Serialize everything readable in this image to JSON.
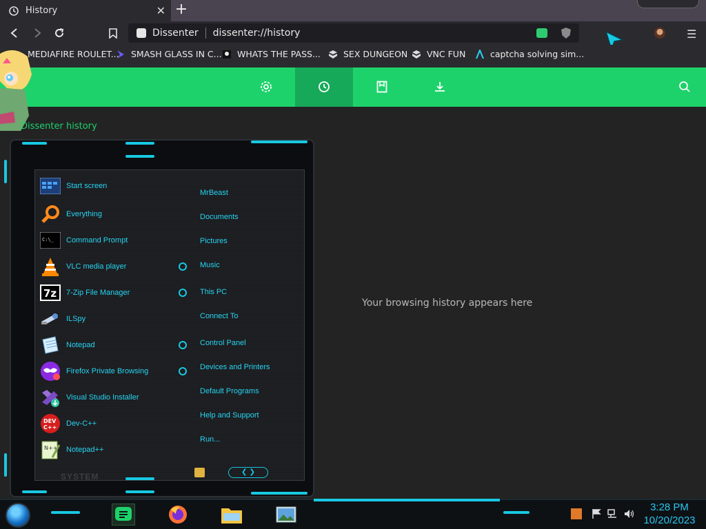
{
  "browser": {
    "tab": {
      "title": "History"
    },
    "address": {
      "site_name": "Dissenter",
      "url": "dissenter://history"
    },
    "bookmarks": [
      {
        "label": "MEDIAFIRE ROULET..."
      },
      {
        "label": "SMASH GLASS IN C..."
      },
      {
        "label": "WHATS THE PASS..."
      },
      {
        "label": "SEX DUNGEON"
      },
      {
        "label": "VNC FUN"
      },
      {
        "label": "captcha solving sim..."
      }
    ]
  },
  "page": {
    "heading": "Dissenter history",
    "empty_message": "Your browsing history appears here",
    "accent_color": "#1ed26b"
  },
  "start_menu": {
    "programs": [
      {
        "label": "Start screen",
        "icon": "start-screen-icon"
      },
      {
        "label": "Everything",
        "icon": "magnifier-icon"
      },
      {
        "label": "Command Prompt",
        "icon": "terminal-icon"
      },
      {
        "label": "VLC media player",
        "icon": "vlc-cone-icon"
      },
      {
        "label": "7-Zip File Manager",
        "icon": "7zip-icon"
      },
      {
        "label": "ILSpy",
        "icon": "ilspy-icon"
      },
      {
        "label": "Notepad",
        "icon": "notepad-icon"
      },
      {
        "label": "Firefox Private Browsing",
        "icon": "firefox-private-icon"
      },
      {
        "label": "Visual Studio Installer",
        "icon": "visual-studio-icon"
      },
      {
        "label": "Dev-C++",
        "icon": "devcpp-icon"
      },
      {
        "label": "Notepad++",
        "icon": "notepadpp-icon"
      }
    ],
    "places": [
      {
        "label": "MrBeast"
      },
      {
        "label": "Documents"
      },
      {
        "label": "Pictures"
      },
      {
        "label": "Music"
      },
      {
        "label": "This PC"
      },
      {
        "label": "Connect To"
      },
      {
        "label": "Control Panel"
      },
      {
        "label": "Devices and Printers"
      },
      {
        "label": "Default Programs"
      },
      {
        "label": "Help and Support"
      },
      {
        "label": "Run..."
      }
    ],
    "system_label": "SYSTEM",
    "accent_color": "#18c9e3"
  },
  "taskbar": {
    "time": "3:28 PM",
    "date": "10/20/2023",
    "apps": [
      "dissenter-icon",
      "firefox-icon",
      "file-explorer-icon",
      "photos-icon"
    ]
  }
}
